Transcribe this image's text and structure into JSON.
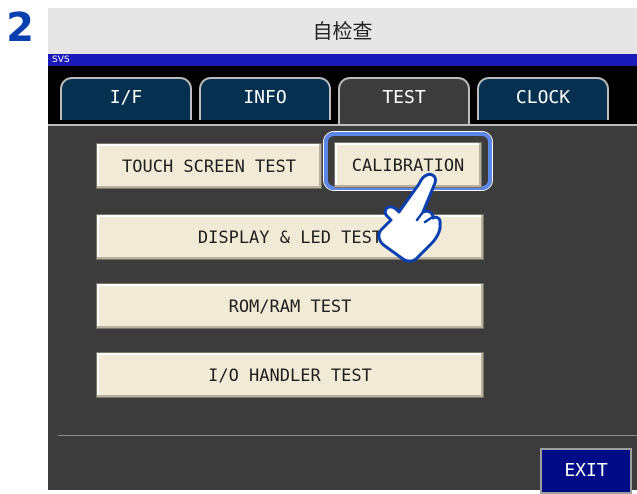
{
  "step_number": "2",
  "window": {
    "title": "自检查"
  },
  "status_bar": {
    "label": "SVS"
  },
  "tabs": [
    {
      "label": "I/F",
      "active": false
    },
    {
      "label": "INFO",
      "active": false
    },
    {
      "label": "TEST",
      "active": true
    },
    {
      "label": "CLOCK",
      "active": false
    }
  ],
  "buttons": {
    "touch_screen_test": "TOUCH SCREEN TEST",
    "calibration": "CALIBRATION",
    "display_led_test": "DISPLAY & LED TEST",
    "rom_ram_test": "ROM/RAM TEST",
    "io_handler_test": "I/O HANDLER TEST",
    "exit": "EXIT"
  },
  "icons": {
    "pointer": "pointing-hand-icon"
  },
  "colors": {
    "step_number": "#0a3fb0",
    "status_bar": "#1a1ab8",
    "tab_inactive": "#063050",
    "panel": "#3c3c3c",
    "button_face": "#f1ead6",
    "highlight": "#5a87e8",
    "exit_button": "#000c85"
  }
}
